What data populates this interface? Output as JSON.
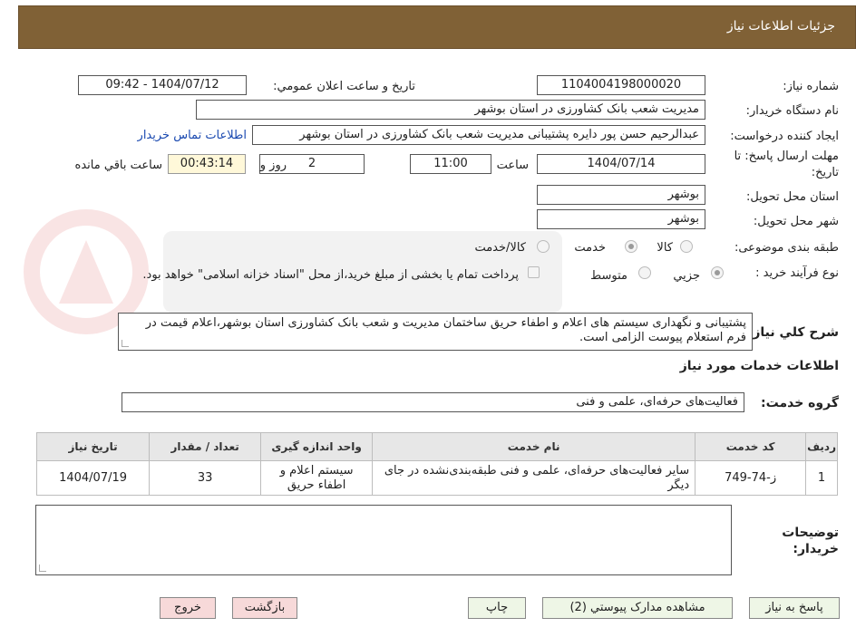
{
  "header": {
    "title": "جزئیات اطلاعات نیاز"
  },
  "form": {
    "need_number_label": "شماره نیاز:",
    "need_number": "1104004198000020",
    "announce_label": "تاریخ و ساعت اعلان عمومي:",
    "announce_value": "1404/07/12 - 09:42",
    "buyer_org_label": "نام دستگاه خریدار:",
    "buyer_org": "مدیریت شعب بانک کشاورزی در استان بوشهر",
    "requester_label": "ایجاد کننده درخواست:",
    "requester": "عبدالرحیم حسن پور دایره پشتیبانی مدیریت شعب بانک کشاورزی در استان بوشهر",
    "contact_link": "اطلاعات تماس خریدار",
    "deadline_label_1": "مهلت ارسال پاسخ: تا",
    "deadline_label_2": "تاریخ:",
    "deadline_date": "1404/07/14",
    "time_label": "ساعت",
    "deadline_time": "11:00",
    "days_value": "2",
    "days_label": "روز و",
    "remaining_time": "00:43:14",
    "remaining_label": "ساعت باقي مانده",
    "province_label": "استان محل تحویل:",
    "province": "بوشهر",
    "city_label": "شهر محل تحویل:",
    "city": "بوشهر",
    "category_label": "طبقه بندی موضوعی:",
    "category_options": [
      "کالا",
      "خدمت",
      "کالا/خدمت"
    ],
    "category_selected": "خدمت",
    "process_label": "نوع فرآیند خرید :",
    "process_options": [
      "جزیي",
      "متوسط"
    ],
    "process_selected": "جزیي",
    "payment_note": "پرداخت تمام یا بخشی از مبلغ خرید،از محل \"اسناد خزانه اسلامی\" خواهد بود.",
    "description_label": "شرح کلي نیاز:",
    "description": "پشتیبانی و نگهداری سیستم های اعلام و اطفاء حریق ساختمان مدیریت و شعب بانک کشاورزی استان بوشهر،اعلام قیمت در فرم استعلام پیوست الزامی است.",
    "services_section": "اطلاعات خدمات مورد نیاز",
    "service_group_label": "گروه خدمت:",
    "service_group": "فعالیت‌های حرفه‌ای، علمی و فنی",
    "buyer_notes_label_1": "توضیحات",
    "buyer_notes_label_2": "خریدار:",
    "buyer_notes": ""
  },
  "table": {
    "headers": {
      "row": "ردیف",
      "code": "کد خدمت",
      "name": "نام خدمت",
      "unit": "واحد اندازه گیری",
      "qty": "تعداد / مقدار",
      "date": "تاریخ نیاز"
    },
    "rows": [
      {
        "row": "1",
        "code": "ز-74-749",
        "name": "سایر فعالیت‌های حرفه‌ای، علمی و فنی طبقه‌بندی‌نشده در جای دیگر",
        "unit": "سیستم اعلام و اطفاء حریق",
        "qty": "33",
        "date": "1404/07/19"
      }
    ]
  },
  "buttons": {
    "reply": "پاسخ به نیاز",
    "attachments": "مشاهده مدارک پیوستي (2)",
    "print": "چاپ",
    "back": "بازگشت",
    "exit": "خروج"
  },
  "colors": {
    "header_bg": "#806136",
    "button_green": "#eef6e6",
    "button_red": "#f7d9d9",
    "link": "#1a49b0"
  }
}
